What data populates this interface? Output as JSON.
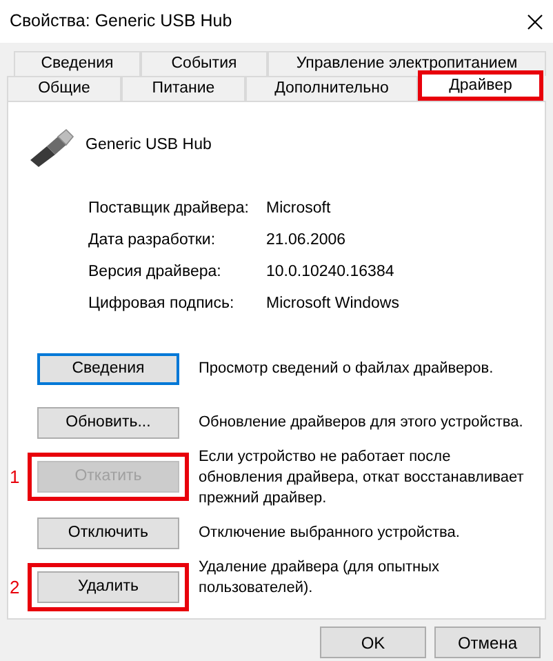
{
  "window": {
    "title": "Свойства: Generic USB Hub"
  },
  "tab_rows": [
    [
      {
        "label": "Сведения",
        "selected": false,
        "highlighted": false
      },
      {
        "label": "События",
        "selected": false,
        "highlighted": false
      },
      {
        "label": "Управление электропитанием",
        "selected": false,
        "highlighted": false
      }
    ],
    [
      {
        "label": "Общие",
        "selected": false,
        "highlighted": false
      },
      {
        "label": "Питание",
        "selected": false,
        "highlighted": false
      },
      {
        "label": "Дополнительно",
        "selected": false,
        "highlighted": false
      },
      {
        "label": "Драйвер",
        "selected": true,
        "highlighted": true
      }
    ]
  ],
  "device": {
    "name": "Generic USB Hub"
  },
  "properties": [
    {
      "label": "Поставщик драйвера:",
      "value": "Microsoft"
    },
    {
      "label": "Дата разработки:",
      "value": "21.06.2006"
    },
    {
      "label": "Версия драйвера:",
      "value": "10.0.10240.16384"
    },
    {
      "label": "Цифровая подпись:",
      "value": "Microsoft Windows"
    }
  ],
  "actions": [
    {
      "label": "Сведения",
      "description": "Просмотр сведений о файлах драйверов.",
      "disabled": false,
      "focused": true,
      "highlighted": false
    },
    {
      "label": "Обновить...",
      "description": "Обновление драйверов для этого устройства.",
      "disabled": false,
      "focused": false,
      "highlighted": false
    },
    {
      "label": "Откатить",
      "description": "Если устройство не работает после обновления драйвера, откат восстанавливает прежний драйвер.",
      "disabled": true,
      "focused": false,
      "highlighted": true,
      "marker": "1"
    },
    {
      "label": "Отключить",
      "description": "Отключение выбранного устройства.",
      "disabled": false,
      "focused": false,
      "highlighted": false
    },
    {
      "label": "Удалить",
      "description": "Удаление драйвера (для опытных пользователей).",
      "disabled": false,
      "focused": false,
      "highlighted": true,
      "marker": "2"
    }
  ],
  "buttons": [
    "OK",
    "Отмена"
  ]
}
